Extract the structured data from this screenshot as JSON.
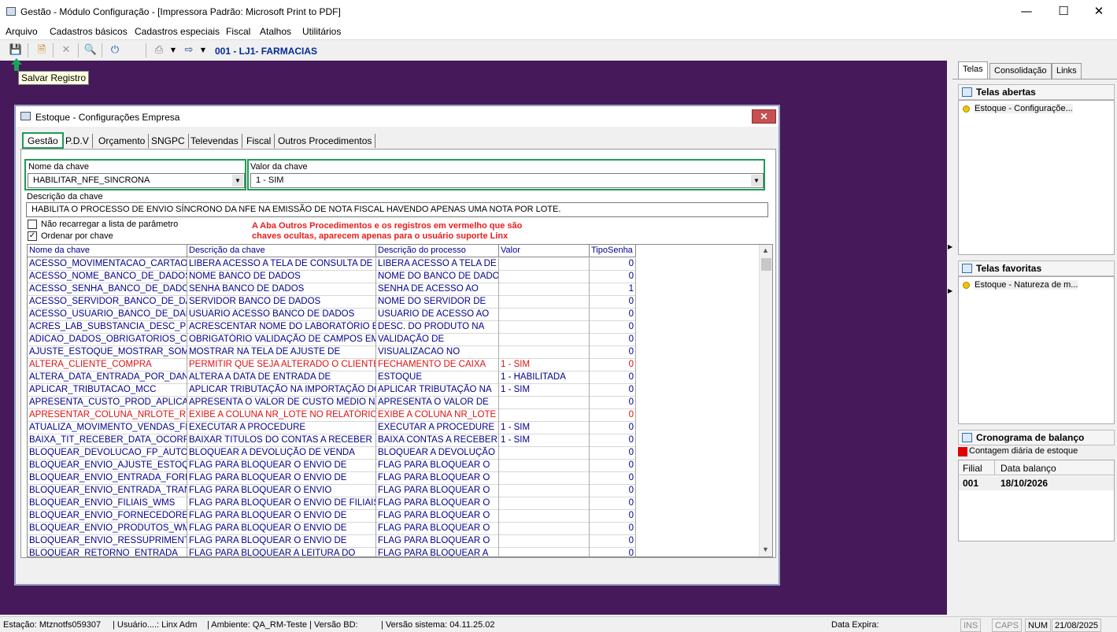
{
  "app": {
    "title": "Gestão - Módulo Configuração - [Impressora Padrão: Microsoft Print to PDF]",
    "company": "001 - LJ1- FARMACIAS",
    "tooltip": "Salvar Registro"
  },
  "menu": [
    "Arquivo",
    "Cadastros básicos",
    "Cadastros especiais",
    "Fiscal",
    "Atalhos",
    "Utilitários"
  ],
  "window": {
    "title": "Estoque - Configurações Empresa",
    "tabs": [
      "Gestão",
      "P.D.V",
      "Orçamento",
      "SNGPC",
      "Televendas",
      "Fiscal",
      "Outros Procedimentos"
    ],
    "key_name_label": "Nome da chave",
    "key_name_value": "HABILITAR_NFE_SINCRONA",
    "key_value_label": "Valor da chave",
    "key_value_value": "1 - SIM",
    "desc_label": "Descrição da chave",
    "desc_value": "HABILITA O PROCESSO DE ENVIO SÍNCRONO DA NFE NA EMISSÃO DE NOTA FISCAL HAVENDO APENAS UMA NOTA POR LOTE.",
    "chk1": "Não recarregar a lista de parâmetro",
    "chk1_checked": false,
    "chk2": "Ordenar por chave",
    "chk2_checked": true,
    "warning_line1": "A Aba Outros Procedimentos e os registros em vermelho que são",
    "warning_line2": "chaves ocultas, aparecem apenas para o usuário suporte Linx",
    "columns": [
      "Nome da chave",
      "Descrição  da chave",
      "Descrição do processo",
      "Valor",
      "TipoSenha"
    ],
    "rows": [
      [
        "ACESSO_MOVIMENTACAO_CARTAO_M",
        "LIBERA ACESSO A TELA DE CONSULTA DE",
        "LIBERA ACESSO A TELA DE",
        "",
        "0",
        false
      ],
      [
        "ACESSO_NOME_BANCO_DE_DADOS",
        "NOME BANCO DE DADOS",
        "NOME DO BANCO DE DADOS",
        "",
        "0",
        false
      ],
      [
        "ACESSO_SENHA_BANCO_DE_DADOS",
        "SENHA BANCO DE DADOS",
        "SENHA DE ACESSO AO",
        "",
        "1",
        false
      ],
      [
        "ACESSO_SERVIDOR_BANCO_DE_DAD",
        "SERVIDOR BANCO DE DADOS",
        "NOME DO SERVIDOR DE",
        "",
        "0",
        false
      ],
      [
        "ACESSO_USUARIO_BANCO_DE_DADC",
        "USUARIO ACESSO BANCO DE DADOS",
        "USUARIO DE ACESSO AO",
        "",
        "0",
        false
      ],
      [
        "ACRES_LAB_SUBSTANCIA_DESC_PRC",
        "ACRESCENTAR NOME DO LABORATÓRIO E",
        "DESC. DO PRODUTO NA",
        "",
        "0",
        false
      ],
      [
        "ADICAO_DADOS_OBRIGATORIOS_CAD",
        "OBRIGATÓRIO VALIDAÇÃO DE CAMPOS EM",
        " VALIDAÇÃO DE",
        "",
        "0",
        false
      ],
      [
        "AJUSTE_ESTOQUE_MOSTRAR_SOME",
        "MOSTRAR NA TELA DE AJUSTE DE",
        "VISUALIZACAO NO",
        "",
        "0",
        false
      ],
      [
        "ALTERA_CLIENTE_COMPRA",
        "PERMITIR QUE SEJA ALTERADO O CLIENTE",
        "FECHAMENTO DE CAIXA",
        "1 - SIM",
        "0",
        true
      ],
      [
        "ALTERA_DATA_ENTRADA_POR_DANF",
        "ALTERA A DATA DE ENTRADA DE",
        "ESTOQUE",
        "1 - HABILITADA",
        "0",
        false
      ],
      [
        "APLICAR_TRIBUTACAO_MCC",
        "APLICAR TRIBUTAÇÃO NA IMPORTAÇÃO DO",
        "APLICAR TRIBUTAÇÃO NA",
        "1 - SIM",
        "0",
        false
      ],
      [
        "APRESENTA_CUSTO_PROD_APLICAC",
        "APRESENTA O VALOR DE CUSTO MÉDIO NA",
        "APRESENTA O VALOR DE",
        "",
        "0",
        false
      ],
      [
        "APRESENTAR_COLUNA_NRLOTE_REI",
        "EXIBE A COLUNA NR_LOTE NO RELATÓRIO",
        "EXIBE A COLUNA NR_LOTE",
        "",
        "0",
        true
      ],
      [
        "ATUALIZA_MOVIMENTO_VENDAS_FEC",
        "EXECUTAR A PROCEDURE",
        "EXECUTAR A PROCEDURE",
        "1 - SIM",
        "0",
        false
      ],
      [
        "BAIXA_TIT_RECEBER_DATA_OCORRE",
        "BAIXAR TITULOS DO CONTAS A RECEBER",
        "BAIXA CONTAS A RECEBER -",
        "1 - SIM",
        "0",
        false
      ],
      [
        "BLOQUEAR_DEVOLUCAO_FP_AUTORI",
        "BLOQUEAR A DEVOLUÇÃO DE VENDA",
        "BLOQUEAR A DEVOLUÇÃO",
        "",
        "0",
        false
      ],
      [
        "BLOQUEAR_ENVIO_AJUSTE_ESTOQU",
        "FLAG PARA BLOQUEAR O ENVIO DE",
        "FLAG PARA BLOQUEAR O",
        "",
        "0",
        false
      ],
      [
        "BLOQUEAR_ENVIO_ENTRADA_FORNE",
        "FLAG PARA BLOQUEAR O ENVIO DE",
        "FLAG PARA BLOQUEAR O",
        "",
        "0",
        false
      ],
      [
        "BLOQUEAR_ENVIO_ENTRADA_TRANS",
        "FLAG PARA BLOQUEAR O ENVIO",
        "FLAG PARA BLOQUEAR O",
        "",
        "0",
        false
      ],
      [
        "BLOQUEAR_ENVIO_FILIAIS_WMS",
        "FLAG PARA BLOQUEAR O ENVIO DE FILIAIS",
        "FLAG PARA BLOQUEAR O",
        "",
        "0",
        false
      ],
      [
        "BLOQUEAR_ENVIO_FORNECEDORES_",
        "FLAG PARA BLOQUEAR O ENVIO DE",
        "FLAG PARA BLOQUEAR O",
        "",
        "0",
        false
      ],
      [
        "BLOQUEAR_ENVIO_PRODUTOS_WMS",
        "FLAG PARA BLOQUEAR O ENVIO DE",
        "FLAG PARA BLOQUEAR O",
        "",
        "0",
        false
      ],
      [
        "BLOQUEAR_ENVIO_RESSUPRIMENTC",
        "FLAG PARA BLOQUEAR O ENVIO DE",
        "FLAG PARA BLOQUEAR O",
        "",
        "0",
        false
      ],
      [
        "BLOQUEAR_RETORNO_ENTRADA",
        "FLAG PARA BLOQUEAR A LEITURA DO",
        "FLAG PARA BLOQUEAR A",
        "",
        "0",
        false
      ]
    ]
  },
  "right": {
    "tabs": [
      "Telas",
      "Consolidação",
      "Links"
    ],
    "open_title": "Telas abertas",
    "open_items": [
      "Estoque - Configuraçõe..."
    ],
    "fav_title": "Telas favoritas",
    "fav_items": [
      "Estoque - Natureza de m..."
    ],
    "cron_title": "Cronograma de balanço",
    "cron_legend": "Contagem diária de estoque",
    "cron_cols": [
      "Filial",
      "Data balanço"
    ],
    "cron_rows": [
      [
        "001",
        "18/10/2026"
      ]
    ]
  },
  "status": {
    "estacao": "Estação: Mtznotfs059307",
    "usuario": "| Usuário....: Linx Adm",
    "ambiente": "| Ambiente: QA_RM-Teste | Versão BD:",
    "versao": "| Versão sistema: 04.11.25.02",
    "expira": "Data Expira:",
    "ins": "INS",
    "caps": "CAPS",
    "num": "NUM",
    "date": "21/08/2025"
  }
}
